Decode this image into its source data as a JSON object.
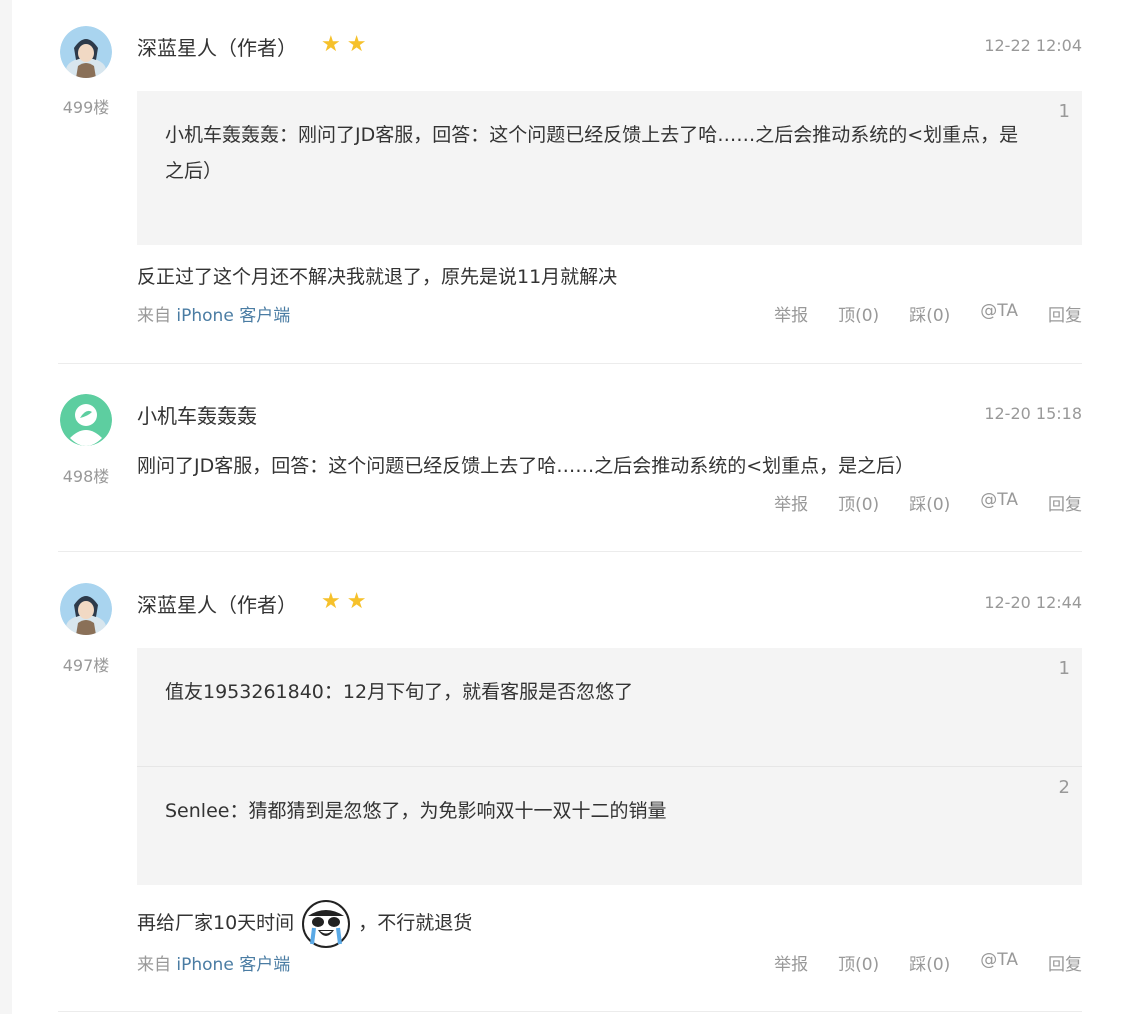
{
  "comments": [
    {
      "floor": "499楼",
      "username": "深蓝星人（作者）",
      "stars": 2,
      "time": "12-22 12:04",
      "quotes": [
        {
          "num": "1",
          "user": "小机车轰轰轰",
          "text": "：刚问了JD客服，回答：这个问题已经反馈上去了哈……之后会推动系统的<划重点，是之后）"
        }
      ],
      "text": "反正过了这个月还不解决我就退了，原先是说11月就解决",
      "source_prefix": "来自",
      "source_link": "iPhone 客户端"
    },
    {
      "floor": "498楼",
      "username": "小机车轰轰轰",
      "time": "12-20 15:18",
      "text": "刚问了JD客服，回答：这个问题已经反馈上去了哈……之后会推动系统的<划重点，是之后）"
    },
    {
      "floor": "497楼",
      "username": "深蓝星人（作者）",
      "stars": 2,
      "time": "12-20 12:44",
      "quotes": [
        {
          "num": "1",
          "user": "值友1953261840",
          "text": "：12月下旬了，就看客服是否忽悠了"
        },
        {
          "num": "2",
          "user": "Senlee",
          "text": "：猜都猜到是忽悠了，为免影响双十一双十二的销量"
        }
      ],
      "text_before_emoji": "再给厂家10天时间",
      "text_after_emoji": "，不行就退货",
      "source_prefix": "来自",
      "source_link": "iPhone 客户端"
    }
  ],
  "actions": {
    "report": "举报",
    "up": "顶(0)",
    "down": "踩(0)",
    "at": "@TA",
    "reply": "回复"
  },
  "colors": {
    "star": "#f6c12b",
    "link": "#4a7ca3",
    "quote_bg": "#f4f4f4",
    "avatar_green": "#5dcea0"
  }
}
